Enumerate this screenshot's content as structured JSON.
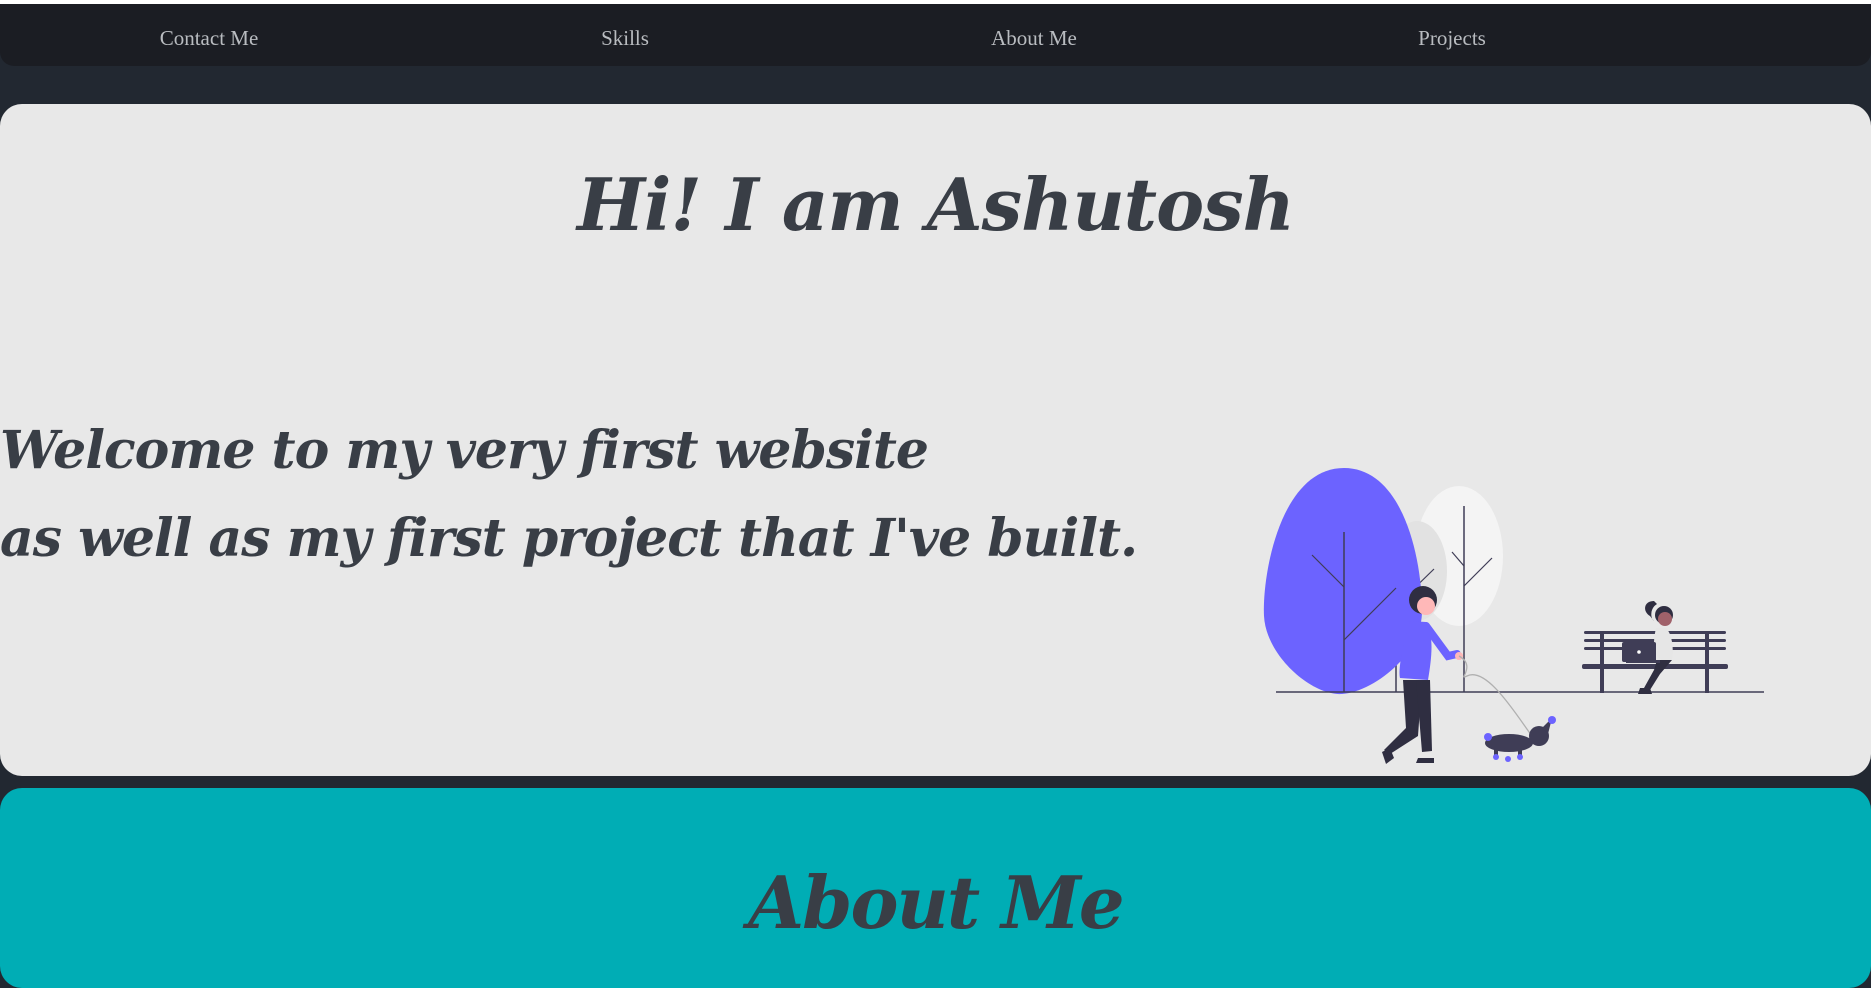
{
  "nav": {
    "links": [
      {
        "label": "Contact Me"
      },
      {
        "label": "Skills"
      },
      {
        "label": "About Me"
      },
      {
        "label": "Projects"
      }
    ]
  },
  "hero": {
    "title": "Hi! I am Ashutosh",
    "welcome_line_1": "Welcome to my very first website",
    "welcome_line_2": "as well as my first project that I've built."
  },
  "about": {
    "title": "About Me"
  },
  "colors": {
    "background": "#222831",
    "navbar": "#1b1d23",
    "hero_panel": "#e8e8e8",
    "heading_text": "#393e46",
    "about_panel": "#00adb5",
    "illustration_accent": "#6c63ff"
  },
  "icons": {
    "illustration": "person-walking-dog-park-illustration"
  }
}
